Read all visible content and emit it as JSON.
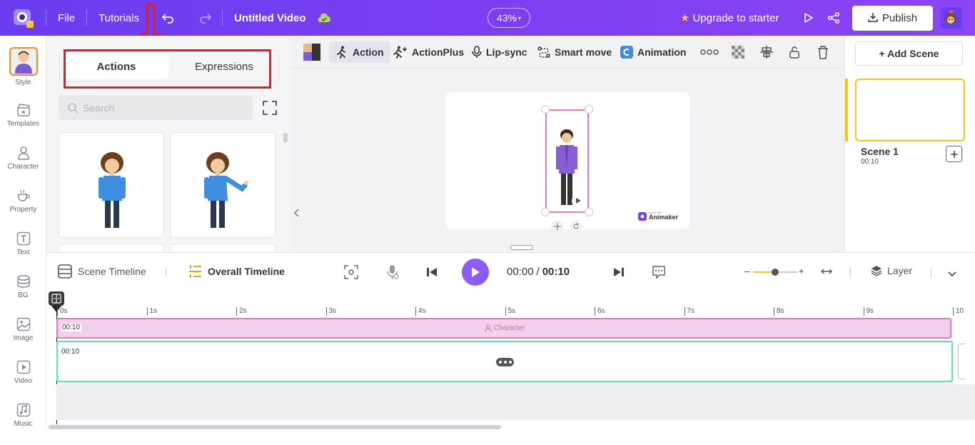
{
  "topbar": {
    "file": "File",
    "tutorials": "Tutorials",
    "title": "Untitled Video",
    "zoom": "43%",
    "upgrade": "Upgrade to starter",
    "publish": "Publish"
  },
  "nav": [
    {
      "label": "Style",
      "icon": "avatar-icon"
    },
    {
      "label": "Templates",
      "icon": "clapperboard-icon"
    },
    {
      "label": "Character",
      "icon": "person-icon"
    },
    {
      "label": "Property",
      "icon": "teacup-icon"
    },
    {
      "label": "Text",
      "icon": "text-icon"
    },
    {
      "label": "BG",
      "icon": "layers-icon"
    },
    {
      "label": "Image",
      "icon": "image-icon"
    },
    {
      "label": "Video",
      "icon": "video-icon"
    },
    {
      "label": "Music",
      "icon": "music-icon"
    }
  ],
  "panel": {
    "tab_actions": "Actions",
    "tab_expressions": "Expressions",
    "search_placeholder": "Search"
  },
  "toolbar": {
    "action": "Action",
    "actionplus": "ActionPlus",
    "lipsync": "Lip-sync",
    "smartmove": "Smart move",
    "animation": "Animation"
  },
  "stage": {
    "watermark_small": "Made with",
    "watermark": "Animaker"
  },
  "scenes": {
    "add": "+ Add Scene",
    "items": [
      {
        "name": "Scene 1",
        "duration": "00:10"
      }
    ]
  },
  "timeline": {
    "scene_tab": "Scene Timeline",
    "overall_tab": "Overall Timeline",
    "current": "00:00",
    "separator": "/",
    "total": "00:10",
    "layer": "Layer",
    "ruler": [
      "0s",
      "1s",
      "2s",
      "3s",
      "4s",
      "5s",
      "6s",
      "7s",
      "8s",
      "9s",
      "10"
    ],
    "track1_time": "00:10",
    "track1_label": "Character",
    "track2_time": "00:10"
  },
  "colors": {
    "brand": "#7b3ff2",
    "highlight_red": "#e01e2a",
    "scene_border": "#f5c518",
    "track_pink": "#f1d0ec",
    "track_green": "#5ee0b8"
  }
}
